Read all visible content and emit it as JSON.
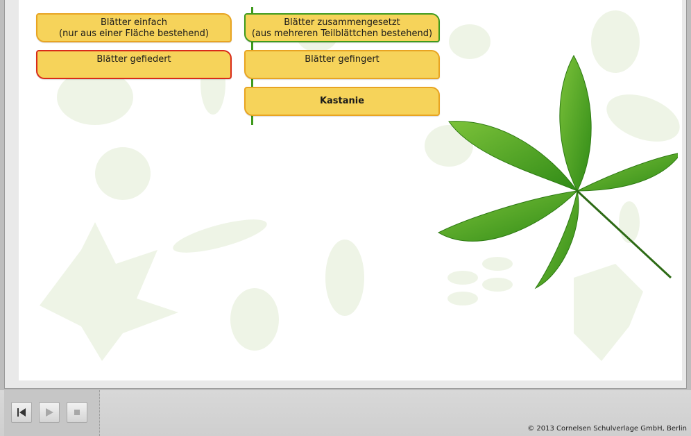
{
  "cards": {
    "simple_line1": "Blätter einfach",
    "simple_line2": "(nur aus einer Fläche bestehend)",
    "compound_line1": "Blätter zusammengesetzt",
    "compound_line2": "(aus mehreren Teilblättchen bestehend)",
    "pinnate": "Blätter gefiedert",
    "palmate": "Blätter gefingert",
    "chestnut": "Kastanie"
  },
  "controls": {
    "rewind_icon": "skip-to-start-icon",
    "play_icon": "play-icon",
    "stop_icon": "stop-icon"
  },
  "footer": {
    "copyright": "© 2013 Cornelsen Schulverlage GmbH, Berlin"
  },
  "colors": {
    "card_fill": "#f6d35a",
    "card_border_orange": "#e8a422",
    "card_border_green": "#3f9a1d",
    "card_border_red": "#d92b1a",
    "leaf_green": "#4da624"
  }
}
